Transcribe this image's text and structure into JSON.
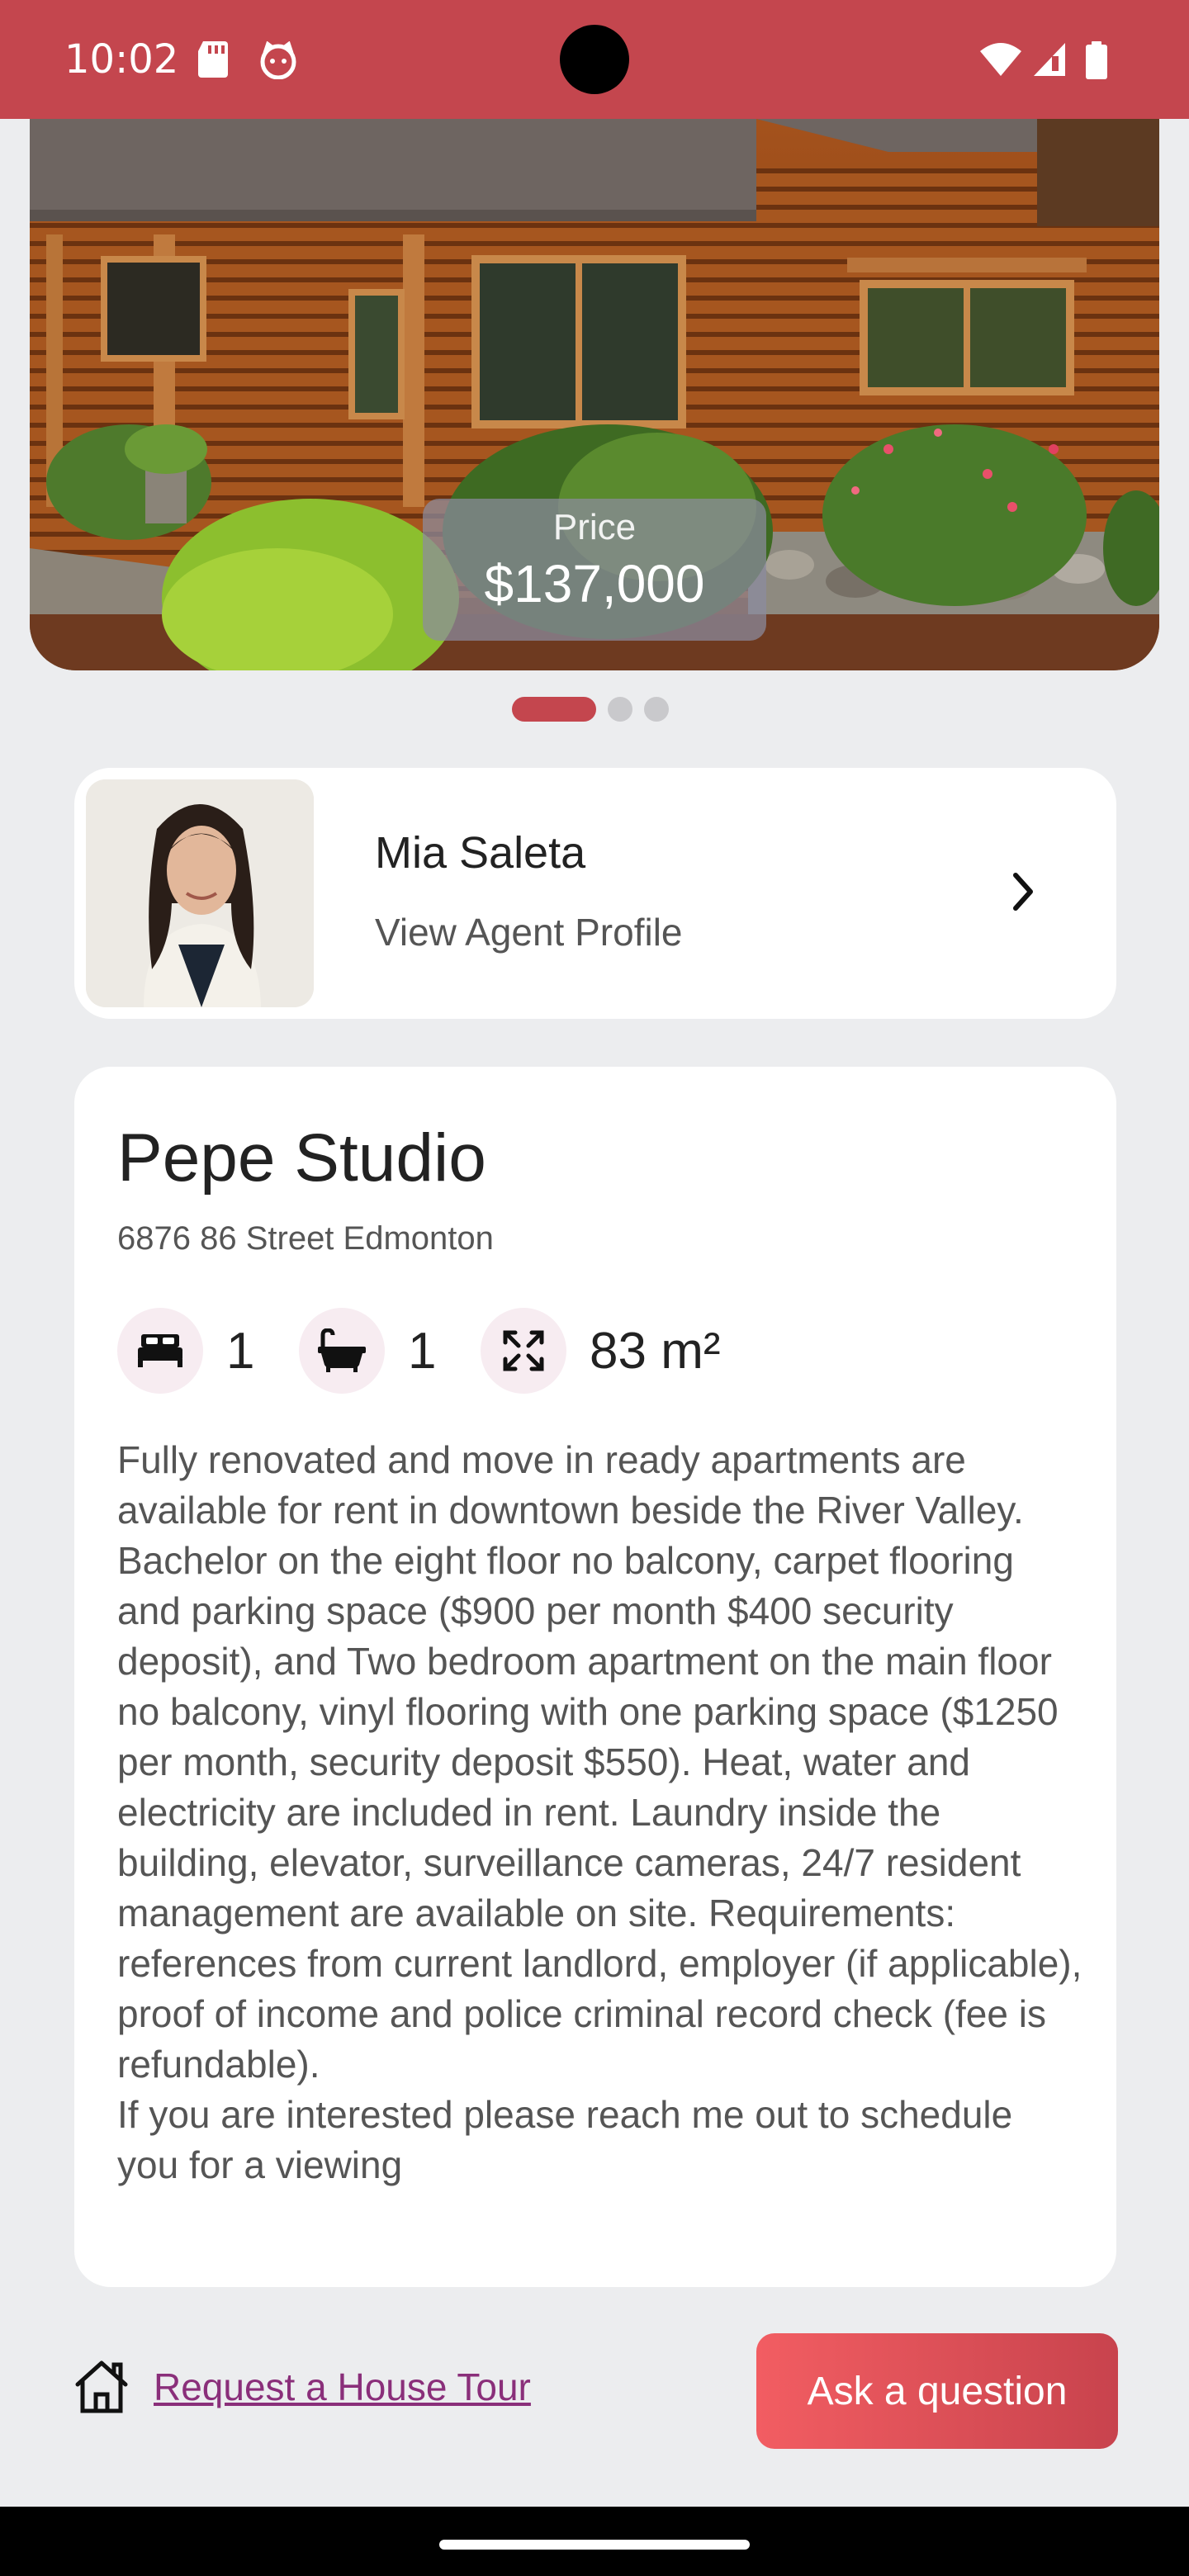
{
  "status_bar": {
    "time": "10:02",
    "icons": [
      "sd-card-icon",
      "cat-face-icon",
      "wifi-icon",
      "signal-icon",
      "battery-icon"
    ]
  },
  "listing": {
    "price_label": "Price",
    "price_value": "$137,000",
    "carousel": {
      "total": 3,
      "active": 1
    }
  },
  "agent": {
    "name": "Mia Saleta",
    "link_label": "View Agent Profile"
  },
  "property": {
    "title": "Pepe Studio",
    "address": "6876 86 Street Edmonton",
    "bedrooms": "1",
    "bathrooms": "1",
    "area": "83 m²",
    "description": "Fully renovated and move in ready apartments are available for rent in downtown beside the River Valley. Bachelor on the eight floor no balcony, carpet flooring and parking space ($900 per month $400 security deposit), and Two bedroom apartment on the main floor no balcony, vinyl flooring with one parking space ($1250 per month, security deposit $550). Heat, water and electricity are included in rent. Laundry inside the building, elevator, surveillance cameras, 24/7 resident management are available on site. Requirements: references from current landlord, employer (if applicable), proof of income and police criminal record check (fee is refundable).\nIf you are interested please reach me out to schedule you for a viewing"
  },
  "actions": {
    "tour_label": "Request a House Tour",
    "ask_label": "Ask a question"
  },
  "colors": {
    "brand": "#C4464E",
    "button_start": "#F25D62",
    "button_end": "#C8434D",
    "link": "#8A2F7A",
    "icon_bg": "#F7ECF1"
  }
}
